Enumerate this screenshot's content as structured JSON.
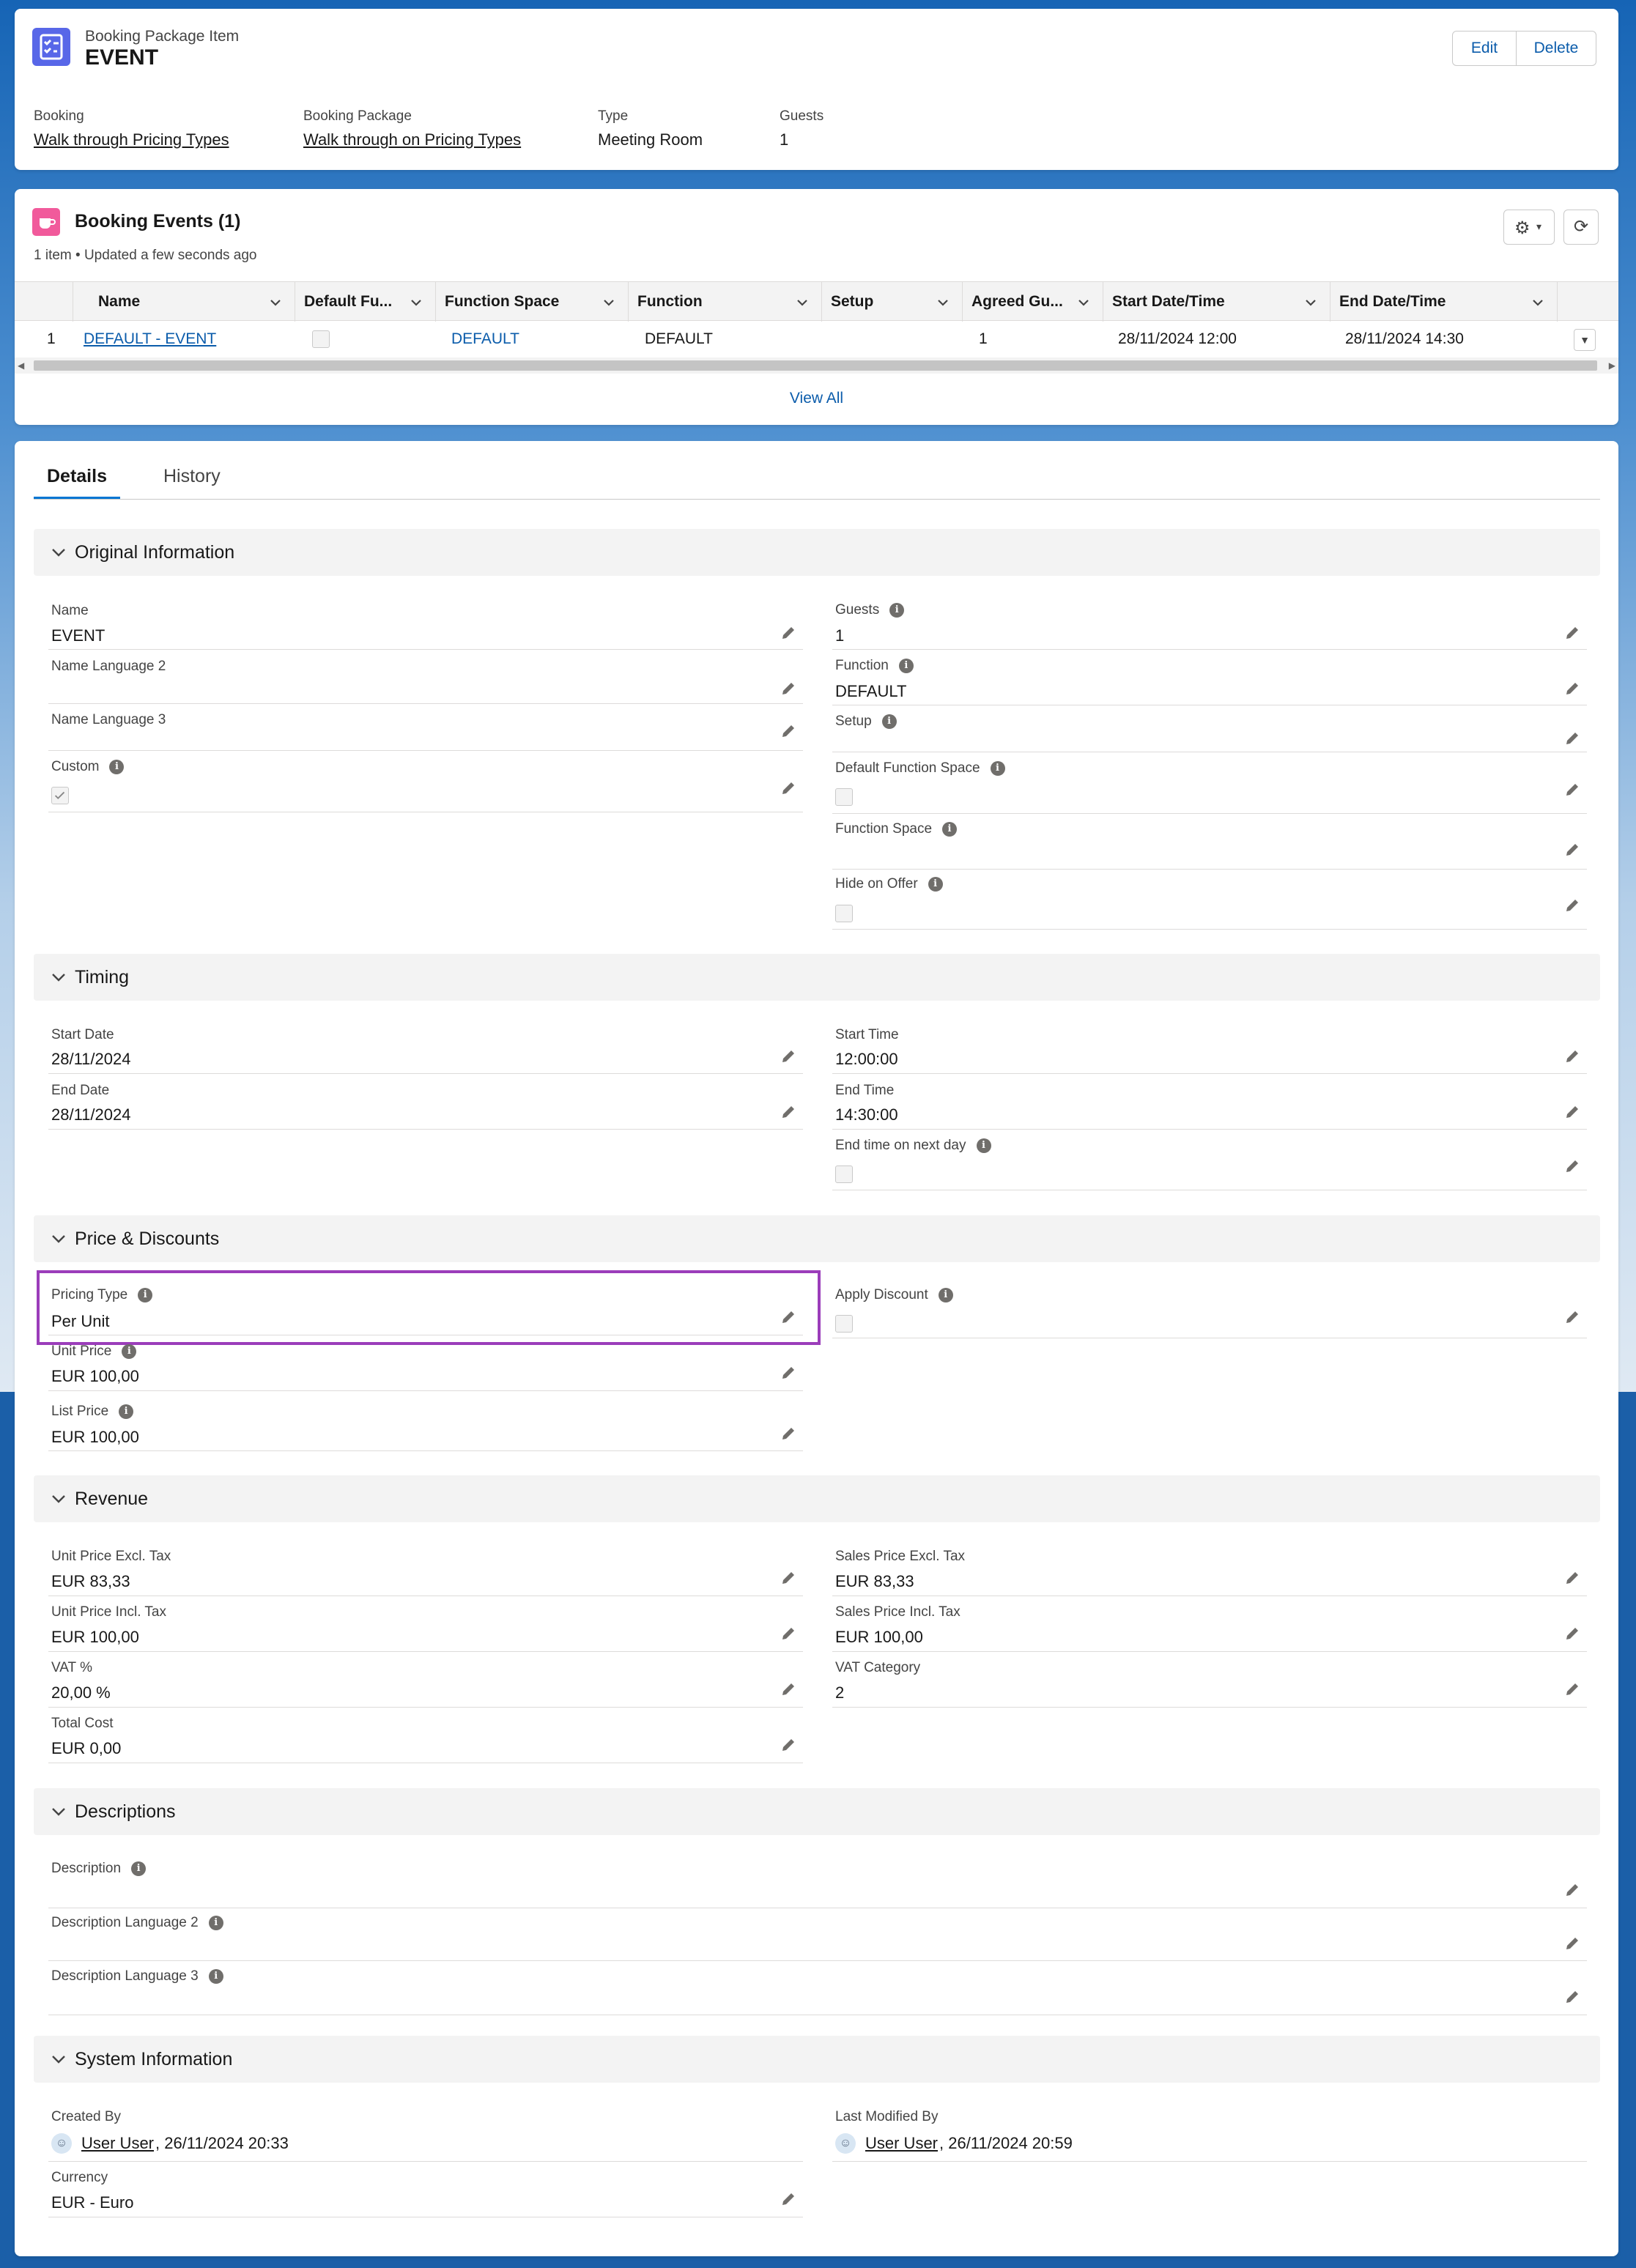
{
  "header": {
    "object_type": "Booking Package Item",
    "title": "EVENT",
    "edit_label": "Edit",
    "delete_label": "Delete",
    "fields": [
      {
        "label": "Booking",
        "value": "Walk through Pricing Types"
      },
      {
        "label": "Booking Package",
        "value": "Walk through on Pricing Types"
      },
      {
        "label": "Type",
        "value": "Meeting Room"
      },
      {
        "label": "Guests",
        "value": "1"
      }
    ]
  },
  "related": {
    "title": "Booking Events (1)",
    "subtitle": "1 item • Updated a few seconds ago",
    "view_all": "View All",
    "columns": [
      "Name",
      "Default Fu...",
      "Function Space",
      "Function",
      "Setup",
      "Agreed Gu...",
      "Start Date/Time",
      "End Date/Time"
    ],
    "rows": [
      {
        "num": "1",
        "name": "DEFAULT - EVENT",
        "default": false,
        "function_space": "DEFAULT",
        "function": "DEFAULT",
        "setup": "",
        "agreed": "1",
        "start": "28/11/2024 12:00",
        "end": "28/11/2024 14:30"
      }
    ]
  },
  "tabs": [
    "Details",
    "History"
  ],
  "sections": {
    "original": {
      "title": "Original Information",
      "name_label": "Name",
      "name_value": "EVENT",
      "name2_label": "Name Language 2",
      "name3_label": "Name Language 3",
      "custom_label": "Custom",
      "custom_checked": true,
      "guests_label": "Guests",
      "guests_value": "1",
      "function_label": "Function",
      "function_value": "DEFAULT",
      "setup_label": "Setup",
      "dfs_label": "Default Function Space",
      "fs_label": "Function Space",
      "hide_label": "Hide on Offer"
    },
    "timing": {
      "title": "Timing",
      "start_date_label": "Start Date",
      "start_date": "28/11/2024",
      "end_date_label": "End Date",
      "end_date": "28/11/2024",
      "start_time_label": "Start Time",
      "start_time": "12:00:00",
      "end_time_label": "End Time",
      "end_time": "14:30:00",
      "next_day_label": "End time on next day"
    },
    "price": {
      "title": "Price & Discounts",
      "pricing_type_label": "Pricing Type",
      "pricing_type": "Per Unit",
      "unit_price_label": "Unit Price",
      "unit_price": "EUR 100,00",
      "list_price_label": "List Price",
      "list_price": "EUR 100,00",
      "apply_discount_label": "Apply Discount"
    },
    "revenue": {
      "title": "Revenue",
      "upe_label": "Unit Price Excl. Tax",
      "upe": "EUR 83,33",
      "upi_label": "Unit Price Incl. Tax",
      "upi": "EUR 100,00",
      "vat_label": "VAT %",
      "vat": "20,00 %",
      "tc_label": "Total Cost",
      "tc": "EUR 0,00",
      "spe_label": "Sales Price Excl. Tax",
      "spe": "EUR 83,33",
      "spi_label": "Sales Price Incl. Tax",
      "spi": "EUR 100,00",
      "vatc_label": "VAT Category",
      "vatc": "2"
    },
    "descriptions": {
      "title": "Descriptions",
      "d1": "Description",
      "d2": "Description Language 2",
      "d3": "Description Language 3"
    },
    "system": {
      "title": "System Information",
      "created_label": "Created By",
      "created_user": "User User",
      "created_date": ", 26/11/2024 20:33",
      "modified_label": "Last Modified By",
      "modified_user": "User User",
      "modified_date": ", 26/11/2024 20:59",
      "currency_label": "Currency",
      "currency": "EUR - Euro"
    }
  },
  "colors": {
    "accent": "#0176d3",
    "highlight": "#9b3dba",
    "brand_icon": "#5867e8",
    "related_icon": "#f15a9b"
  }
}
